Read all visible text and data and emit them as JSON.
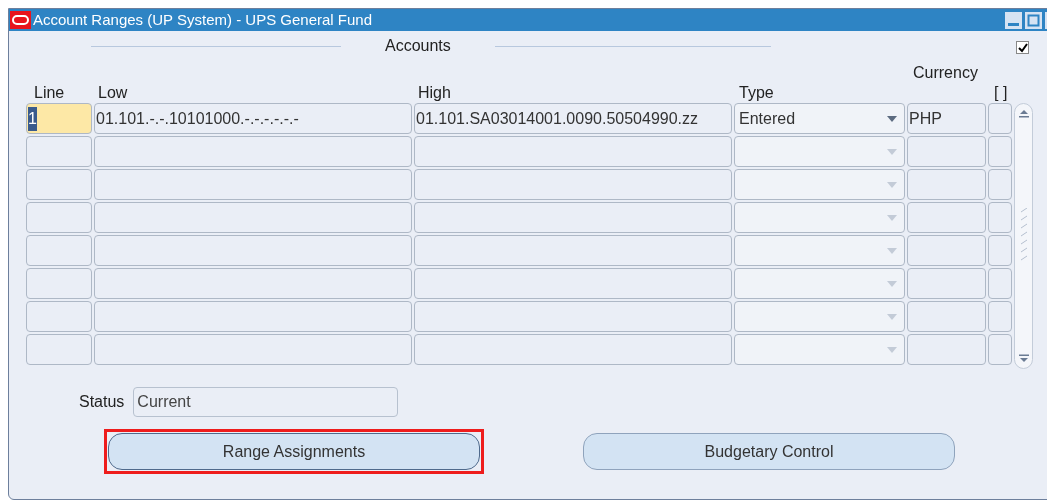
{
  "window": {
    "title": "Account Ranges (UP System) - UPS General Fund"
  },
  "section": {
    "title": "Accounts",
    "checkbox_checked": true
  },
  "table": {
    "columns": [
      "Line",
      "Low",
      "High",
      "Type",
      "Currency",
      "[ ]"
    ],
    "rows": [
      {
        "selected": true,
        "line": "1",
        "low": "01.101.-.-.10101000.-.-.-.-.-.-",
        "high": "01.101.SA03014001.0090.50504990.zz",
        "type": "Entered",
        "currency": "PHP"
      },
      {
        "selected": false
      },
      {
        "selected": false
      },
      {
        "selected": false
      },
      {
        "selected": false
      },
      {
        "selected": false
      },
      {
        "selected": false
      },
      {
        "selected": false
      }
    ]
  },
  "status": {
    "label": "Status",
    "value": "Current"
  },
  "buttons": [
    {
      "label": "Range Assignments",
      "highlighted": true
    },
    {
      "label": "Budgetary Control",
      "highlighted": false
    }
  ]
}
